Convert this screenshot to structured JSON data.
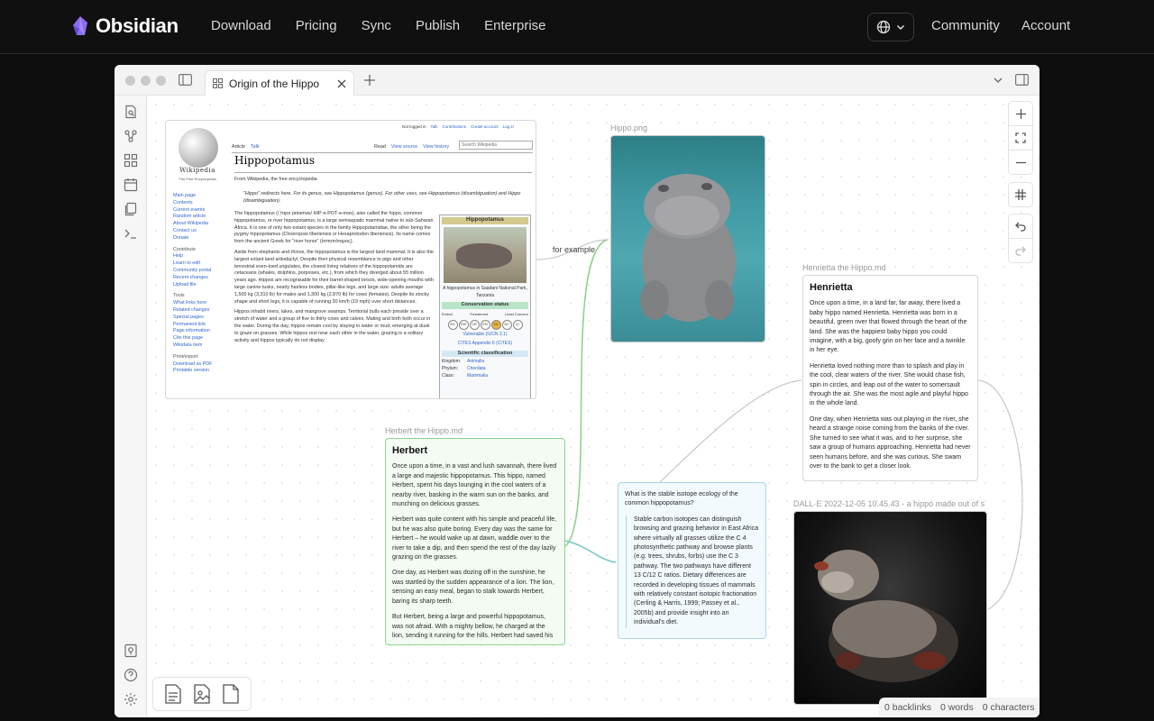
{
  "site": {
    "brand": "Obsidian",
    "nav": [
      "Download",
      "Pricing",
      "Sync",
      "Publish",
      "Enterprise"
    ],
    "community": "Community",
    "account": "Account"
  },
  "app": {
    "tab_title": "Origin of the Hippo",
    "edge_label": "for example",
    "image_label": "Hippo.png",
    "dalle_label": "DALL·E 2022-12-05 10.45.43 - a hippo made out of s",
    "henrietta": {
      "filename": "Henrietta the Hippo.md",
      "title": "Henrietta",
      "p1": "Once upon a time, in a land far, far away, there lived a baby hippo named Henrietta. Henrietta was born in a beautiful, green river that flowed through the heart of the land. She was the happiest baby hippo you could imagine, with a big, goofy grin on her face and a twinkle in her eye.",
      "p2": "Henrietta loved nothing more than to splash and play in the cool, clear waters of the river. She would chase fish, spin in circles, and leap out of the water to somersault through the air. She was the most agile and playful hippo in the whole land.",
      "p3": "One day, when Henrietta was out playing in the river, she heard a strange noise coming from the banks of the river. She turned to see what it was, and to her surprise, she saw a group of humans approaching. Henrietta had never seen humans before, and she was curious. She swam over to the bank to get a closer look."
    },
    "herbert": {
      "filename": "Herbert the Hippo.md",
      "title": "Herbert",
      "p1": "Once upon a time, in a vast and lush savannah, there lived a large and majestic hippopotamus. This hippo, named Herbert, spent his days lounging in the cool waters of a nearby river, basking in the warm sun on the banks, and munching on delicious grasses.",
      "p2": "Herbert was quite content with his simple and peaceful life, but he was also quite boring. Every day was the same for Herbert – he would wake up at dawn, waddle over to the river to take a dip, and then spend the rest of the day lazily grazing on the grasses.",
      "p3": "One day, as Herbert was dozing off in the sunshine, he was startled by the sudden appearance of a lion. The lion, sensing an easy meal, began to stalk towards Herbert, baring its sharp teeth.",
      "p4": "But Herbert, being a large and powerful hippopotamus, was not afraid. With a mighty bellow, he charged at the lion, sending it running for the hills. Herbert had saved his"
    },
    "isotope": {
      "question": "What is the stable isotope ecology of the common hippopotamus?",
      "answer": "Stable carbon isotopes can distinguish browsing and grazing behavior in East Africa where virtually all grasses utilize the C 4 photosynthetic pathway and browse plants (e.g. trees, shrubs, forbs) use the C 3 pathway. The two pathways have different 13 C/12 C ratios. Dietary differences are recorded in developing tissues of mammals with relatively constant isotopic fractionation (Cerling & Harris, 1999; Passey et al., 2005b) and provide insight into an individual's diet."
    },
    "wiki": {
      "title": "Hippopotamus",
      "logo": "Wikipedia",
      "logo_sub": "The Free Encyclopedia",
      "from": "From Wikipedia, the free encyclopedia",
      "redirect": "\"Hippo\" redirects here. For its genus, see Hippopotamus (genus). For other uses, see Hippopotamus (disambiguation) and Hippo (disambiguation).",
      "para1": "The hippopotamus (/ˌhɪpəˈpɒtəməs/ HIP-ə-POT-ə-məs), also called the hippo, common hippopotamus, or river hippopotamus, is a large semiaquatic mammal native to sub-Saharan Africa. It is one of only two extant species in the family Hippopotamidae, the other being the pygmy hippopotamus (Choeropsis liberiensis or Hexaprotodon liberiensis). Its name comes from the ancient Greek for \"river horse\" (ἱπποπόταμος).",
      "para2": "Aside from elephants and rhinos, the hippopotamus is the largest land mammal. It is also the largest extant land artiodactyl. Despite their physical resemblance to pigs and other terrestrial even-toed ungulates, the closest living relatives of the hippopotamids are cetaceans (whales, dolphins, porpoises, etc.), from which they diverged about 55 million years ago. Hippos are recognisable for their barrel-shaped torsos, wide-opening mouths with large canine tusks, nearly hairless bodies, pillar-like legs, and large size: adults average 1,500 kg (3,310 lb) for males and 1,300 kg (2,870 lb) for cows (females). Despite its stocky shape and short legs, it is capable of running 30 km/h (19 mph) over short distances.",
      "para3": "Hippos inhabit rivers, lakes, and mangrove swamps. Territorial bulls each preside over a stretch of water and a group of five to thirty cows and calves. Mating and birth both occur in the water. During the day, hippos remain cool by staying in water or mud, emerging at dusk to graze on grasses. While hippos rest near each other in the water, grazing is a solitary activity and hippos typically do not display",
      "sidebar": [
        "Main page",
        "Contents",
        "Current events",
        "Random article",
        "About Wikipedia",
        "Contact us",
        "Donate"
      ],
      "contribute_h": "Contribute",
      "contribute": [
        "Help",
        "Learn to edit",
        "Community portal",
        "Recent changes",
        "Upload file"
      ],
      "tools_h": "Tools",
      "tools": [
        "What links here",
        "Related changes",
        "Special pages",
        "Permanent link",
        "Page information",
        "Cite this page",
        "Wikidata item"
      ],
      "print_h": "Print/export",
      "print": [
        "Download as PDF",
        "Printable version"
      ],
      "tabs": [
        "Article",
        "Talk"
      ],
      "actions": [
        "Read",
        "View source",
        "View history"
      ],
      "search_placeholder": "Search Wikipedia",
      "user_bar": [
        "Not logged in",
        "Talk",
        "Contributions",
        "Create account",
        "Log in"
      ],
      "infobox_title": "Hippopotamus",
      "infobox_caption": "A hippopotamus in Saadani National Park, Tanzania",
      "conservation": "Conservation status",
      "cons_heads": [
        "Extinct",
        "Threatened",
        "Least Concern"
      ],
      "cons_codes": [
        "EX",
        "EW",
        "CR",
        "EN",
        "VU",
        "NT",
        "LC"
      ],
      "vulnerable": "Vulnerable (IUCN 3.1)",
      "cites": "CITES Appendix II (CITES)",
      "sci": "Scientific classification",
      "kingdom_k": "Kingdom:",
      "kingdom_v": "Animalia",
      "phylum_k": "Phylum:",
      "phylum_v": "Chordata",
      "class_k": "Class:",
      "class_v": "Mammalia"
    },
    "status": {
      "backlinks": "0 backlinks",
      "words": "0 words",
      "chars": "0 characters"
    }
  }
}
